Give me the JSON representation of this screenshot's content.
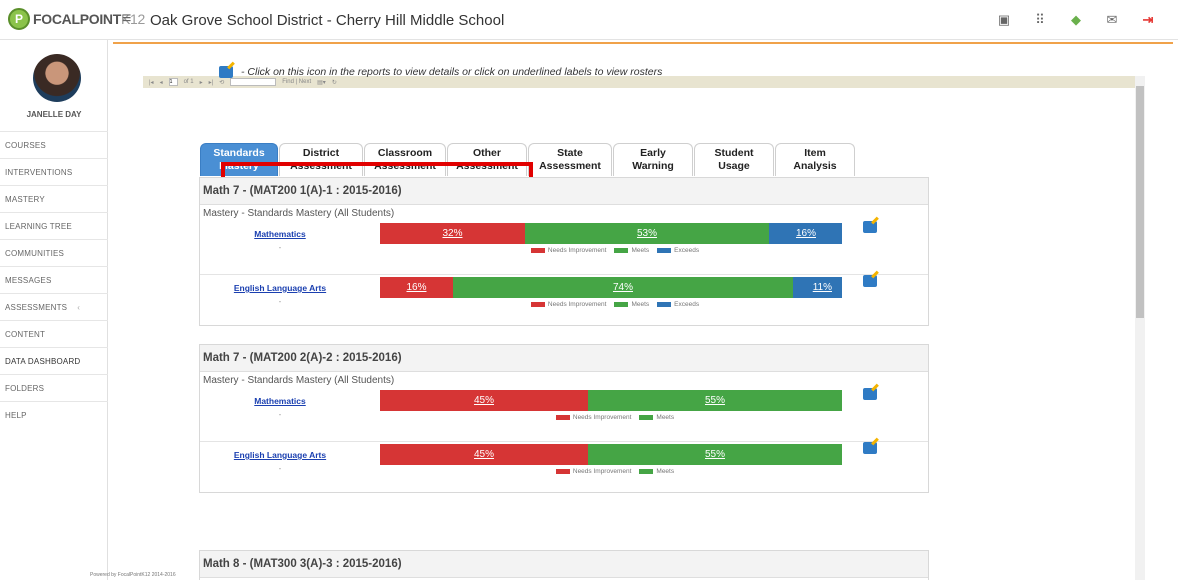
{
  "app": {
    "logo_main": "FOCALPOINT",
    "logo_suffix": "K12",
    "title": "Oak Grove School District - Cherry Hill Middle School"
  },
  "topbar_icons": [
    "id-card-icon",
    "apps-grid-icon",
    "notifications-icon",
    "mail-icon",
    "logout-icon"
  ],
  "user": {
    "name": "JANELLE DAY"
  },
  "sidebar": {
    "items": [
      {
        "label": "COURSES"
      },
      {
        "label": "INTERVENTIONS"
      },
      {
        "label": "MASTERY"
      },
      {
        "label": "LEARNING TREE"
      },
      {
        "label": "COMMUNITIES"
      },
      {
        "label": "MESSAGES"
      },
      {
        "label": "ASSESSMENTS",
        "chevron": "‹"
      },
      {
        "label": "CONTENT"
      },
      {
        "label": "DATA DASHBOARD"
      },
      {
        "label": "FOLDERS"
      },
      {
        "label": "HELP"
      }
    ]
  },
  "report_toolbar": {
    "page_value": "1",
    "page_of": "of 1",
    "find_next": "Find | Next"
  },
  "instruction": "- Click on this icon in the reports to view details or click on underlined labels to view rosters",
  "tabs": [
    {
      "line1": "Standards",
      "line2": "Mastery"
    },
    {
      "line1": "District",
      "line2": "Assessment"
    },
    {
      "line1": "Classroom",
      "line2": "Assessment"
    },
    {
      "line1": "Other",
      "line2": "Assessment"
    },
    {
      "line1": "State",
      "line2": "Assessment"
    },
    {
      "line1": "Early",
      "line2": "Warning"
    },
    {
      "line1": "Student",
      "line2": "Usage"
    },
    {
      "line1": "Item",
      "line2": "Analysis"
    }
  ],
  "legend": {
    "needs": "Needs Improvement",
    "meets": "Meets",
    "exceeds": "Exceeds"
  },
  "colors": {
    "needs_improvement": "#d63535",
    "meets": "#45a545",
    "exceeds": "#2f74b5",
    "active_tab": "#4a8fd4",
    "highlight": "#e10000"
  },
  "panels": [
    {
      "title": "Math 7 - (MAT200 1(A)-1 : 2015-2016)",
      "subtitle": "Mastery - Standards Mastery (All Students)",
      "rows": [
        {
          "subject": "Mathematics",
          "dash": "-",
          "needs": "32%",
          "meets": "53%",
          "exceeds": "16%"
        },
        {
          "subject": "English Language Arts",
          "dash": "-",
          "needs": "16%",
          "meets": "74%",
          "exceeds": "11%"
        }
      ]
    },
    {
      "title": "Math 7 - (MAT200 2(A)-2 : 2015-2016)",
      "subtitle": "Mastery - Standards Mastery (All Students)",
      "rows": [
        {
          "subject": "Mathematics",
          "dash": "-",
          "needs": "45%",
          "meets": "55%"
        },
        {
          "subject": "English Language Arts",
          "dash": "-",
          "needs": "45%",
          "meets": "55%"
        }
      ]
    },
    {
      "title": "Math 8 - (MAT300 3(A)-3 : 2015-2016)"
    }
  ],
  "footer": "Powered by FocalPointK12 2014-2016"
}
